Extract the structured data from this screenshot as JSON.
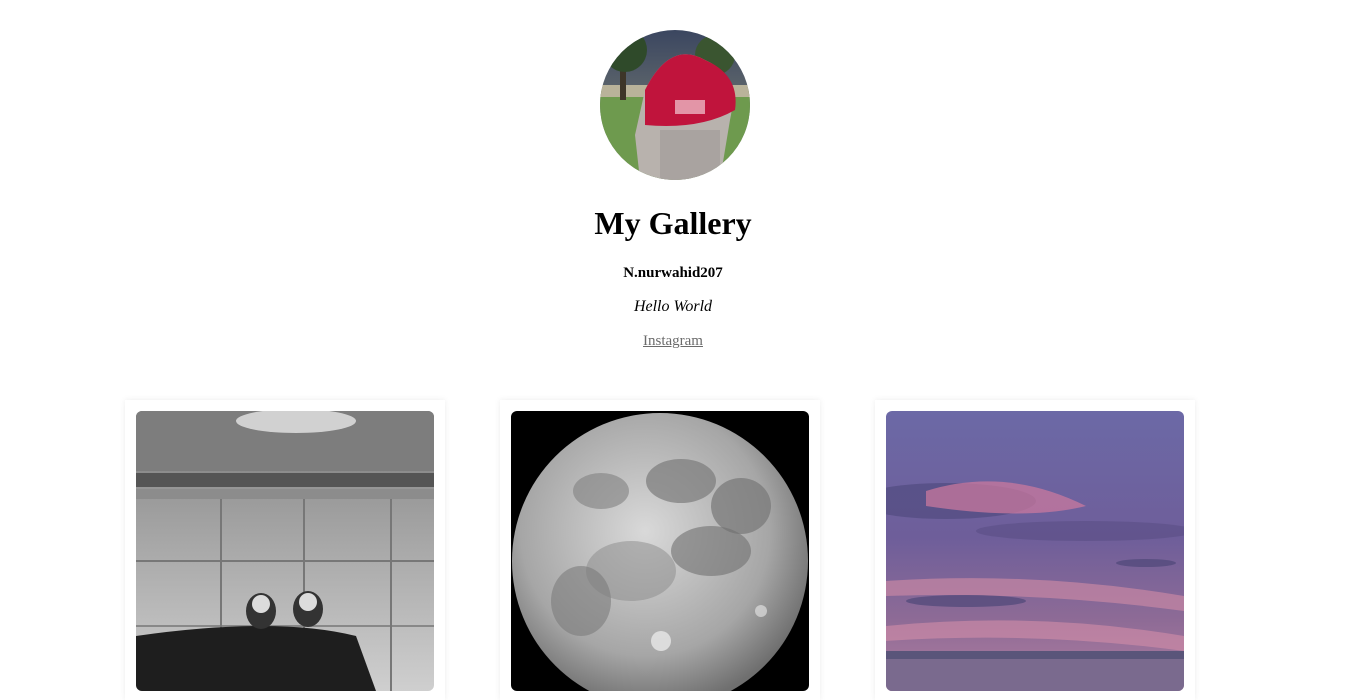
{
  "profile": {
    "title": "My Gallery",
    "username": "N.nurwahid207",
    "tagline": "Hello World",
    "link_label": "Instagram"
  },
  "gallery": [
    {
      "subject": "black-and-white photo of sneakers on tiled floor"
    },
    {
      "subject": "full moon on black sky"
    },
    {
      "subject": "purple and pink sunset sky"
    }
  ]
}
